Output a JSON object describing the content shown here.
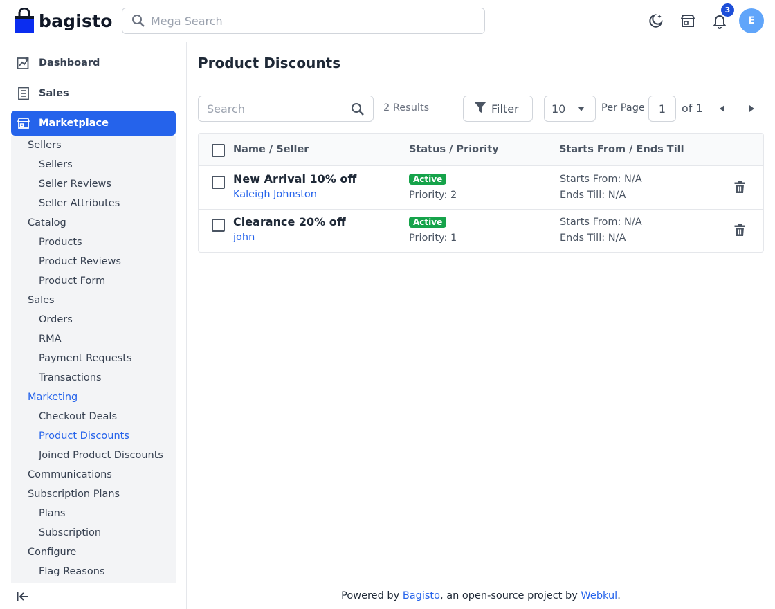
{
  "header": {
    "logo_text": "bagisto",
    "search_placeholder": "Mega Search",
    "notification_count": "3",
    "avatar_initial": "E",
    "icons": [
      "bag-logo-icon",
      "search-icon",
      "dark-mode-icon",
      "store-icon",
      "bell-icon"
    ]
  },
  "sidebar": {
    "top_items": [
      {
        "label": "Dashboard",
        "icon": "dashboard-icon"
      },
      {
        "label": "Sales",
        "icon": "sales-icon"
      },
      {
        "label": "Marketplace",
        "icon": "marketplace-icon",
        "active": true
      }
    ],
    "submenu": [
      {
        "label": "Sellers",
        "level": 1
      },
      {
        "label": "Sellers",
        "level": 2
      },
      {
        "label": "Seller Reviews",
        "level": 2
      },
      {
        "label": "Seller Attributes",
        "level": 2
      },
      {
        "label": "Catalog",
        "level": 1
      },
      {
        "label": "Products",
        "level": 2
      },
      {
        "label": "Product Reviews",
        "level": 2
      },
      {
        "label": "Product Form",
        "level": 2
      },
      {
        "label": "Sales",
        "level": 1
      },
      {
        "label": "Orders",
        "level": 2
      },
      {
        "label": "RMA",
        "level": 2
      },
      {
        "label": "Payment Requests",
        "level": 2
      },
      {
        "label": "Transactions",
        "level": 2
      },
      {
        "label": "Marketing",
        "level": 1,
        "selected": true
      },
      {
        "label": "Checkout Deals",
        "level": 2
      },
      {
        "label": "Product Discounts",
        "level": 2,
        "selected": true
      },
      {
        "label": "Joined Product Discounts",
        "level": 2
      },
      {
        "label": "Communications",
        "level": 1
      },
      {
        "label": "Subscription Plans",
        "level": 1
      },
      {
        "label": "Plans",
        "level": 2
      },
      {
        "label": "Subscription",
        "level": 2
      },
      {
        "label": "Configure",
        "level": 1
      },
      {
        "label": "Flag Reasons",
        "level": 2
      }
    ],
    "collapse_icon": "collapse-sidebar-icon"
  },
  "main": {
    "title": "Product Discounts",
    "search_placeholder": "Search",
    "results_text": "2 Results",
    "filter_label": "Filter",
    "per_page_value": "10",
    "per_page_label": "Per Page",
    "current_page": "1",
    "of_pages": "of 1",
    "columns": [
      "Name / Seller",
      "Status / Priority",
      "Starts From / Ends Till"
    ],
    "rows": [
      {
        "name": "New Arrival 10% off",
        "seller": "Kaleigh Johnston",
        "status": "Active",
        "priority": "Priority: 2",
        "starts": "Starts From: N/A",
        "ends": "Ends Till: N/A"
      },
      {
        "name": "Clearance 20% off",
        "seller": "john",
        "status": "Active",
        "priority": "Priority: 1",
        "starts": "Starts From: N/A",
        "ends": "Ends Till: N/A"
      }
    ]
  },
  "footer": {
    "prefix": "Powered by ",
    "link1": "Bagisto",
    "middle": ", an open-source project by ",
    "link2": "Webkul",
    "suffix": "."
  },
  "colors": {
    "accent": "#2563eb",
    "badge_green": "#16a34a",
    "notification_badge": "#1d4ed8",
    "avatar": "#60a5fa"
  }
}
